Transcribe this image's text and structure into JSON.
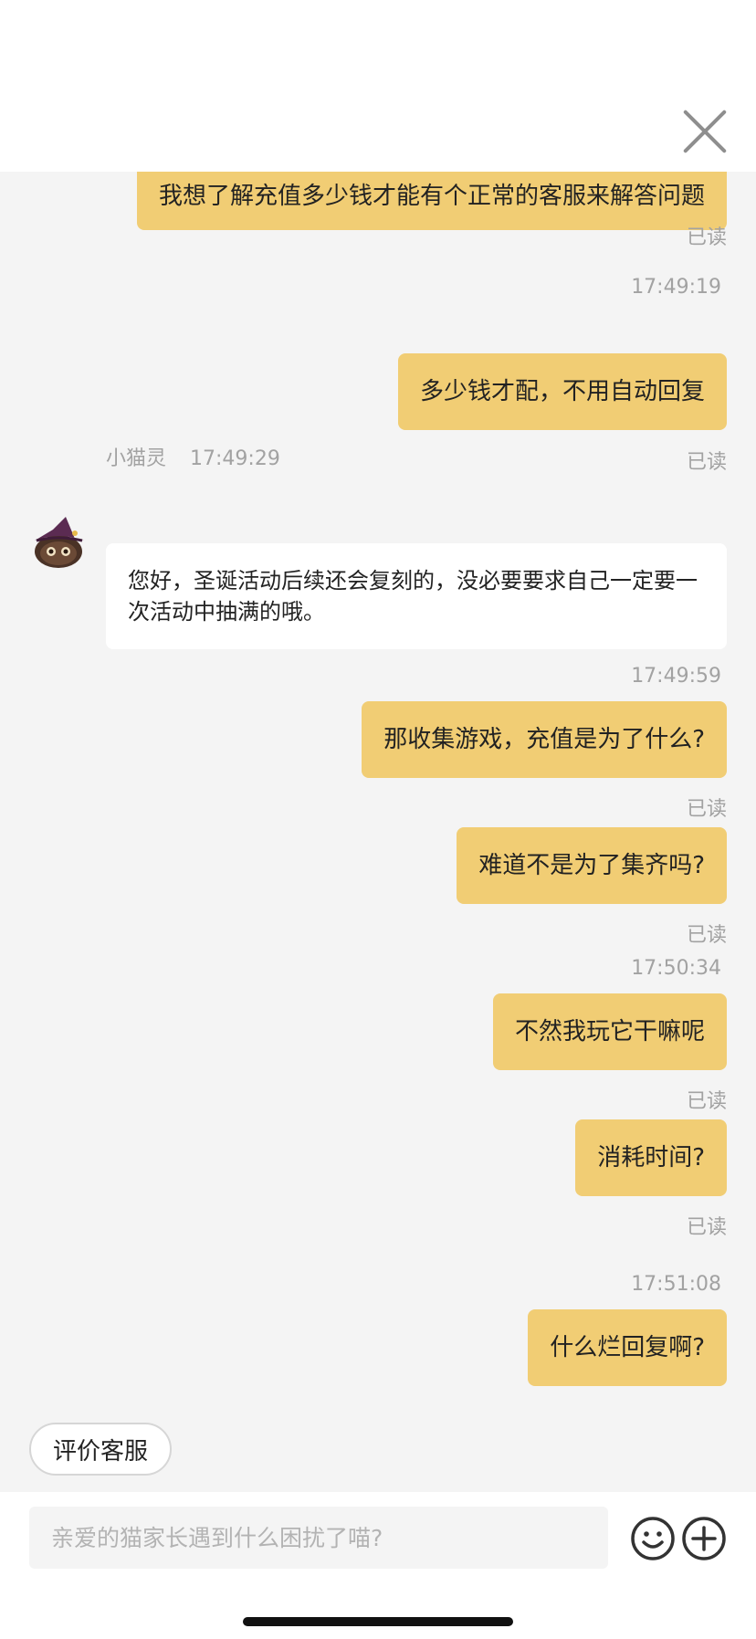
{
  "icons": {
    "close": "close-icon",
    "emoji": "smiley-icon",
    "plus": "plus-circle-icon",
    "avatar": "cat-witch-avatar"
  },
  "colors": {
    "outgoing_bubble": "#f1cd74",
    "incoming_bubble": "#ffffff",
    "background": "#f4f4f4"
  },
  "messages": [
    {
      "text": "我想了解充值多少钱才能有个正常的客服来解答问题",
      "status": "已读"
    },
    {
      "time": "17:49:19"
    },
    {
      "text": "多少钱才配，不用自动回复",
      "status": "已读"
    },
    {
      "sender": "小猫灵",
      "time": "17:49:29",
      "text": "您好，圣诞活动后续还会复刻的，没必要要求自己一定要一次活动中抽满的哦。"
    },
    {
      "time": "17:49:59"
    },
    {
      "text": "那收集游戏，充值是为了什么?",
      "status": "已读"
    },
    {
      "text": "难道不是为了集齐吗?",
      "status": "已读"
    },
    {
      "time": "17:50:34"
    },
    {
      "text": "不然我玩它干嘛呢",
      "status": "已读"
    },
    {
      "text": "消耗时间?",
      "status": "已读"
    },
    {
      "time": "17:51:08"
    },
    {
      "text": "什么烂回复啊?",
      "status": "已读"
    }
  ],
  "rate_button": "评价客服",
  "input": {
    "placeholder": "亲爱的猫家长遇到什么困扰了喵?"
  }
}
